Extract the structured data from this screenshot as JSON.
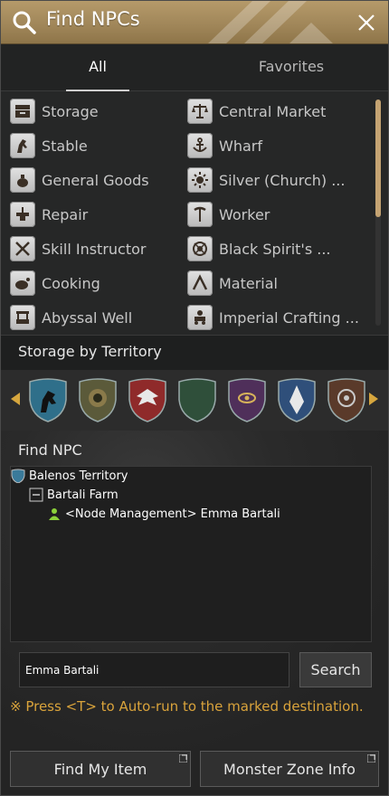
{
  "header": {
    "title": "Find NPCs"
  },
  "tabs": [
    {
      "label": "All",
      "active": true
    },
    {
      "label": "Favorites",
      "active": false
    }
  ],
  "categories": {
    "left": [
      {
        "label": "Storage",
        "icon": "storage-icon"
      },
      {
        "label": "Stable",
        "icon": "horse-icon"
      },
      {
        "label": "General Goods",
        "icon": "sack-icon"
      },
      {
        "label": "Repair",
        "icon": "anvil-icon"
      },
      {
        "label": "Skill Instructor",
        "icon": "crossed-weapons-icon"
      },
      {
        "label": "Cooking",
        "icon": "chicken-icon"
      },
      {
        "label": "Abyssal Well",
        "icon": "well-icon"
      }
    ],
    "right": [
      {
        "label": "Central Market",
        "icon": "scales-icon"
      },
      {
        "label": "Wharf",
        "icon": "anchor-icon"
      },
      {
        "label": "Silver (Church) ...",
        "icon": "sun-emblem-icon"
      },
      {
        "label": "Worker",
        "icon": "pickaxe-icon"
      },
      {
        "label": "Black Spirit's ...",
        "icon": "spirit-icon"
      },
      {
        "label": "Material",
        "icon": "wishbone-icon"
      },
      {
        "label": "Imperial Crafting ...",
        "icon": "cart-icon"
      }
    ]
  },
  "territory": {
    "title": "Storage by Territory",
    "shields": [
      {
        "name": "balenos",
        "color": "#2f6f8a",
        "icon": "horse-crest-icon"
      },
      {
        "name": "serendia",
        "color": "#5b5a3a",
        "icon": "lion-crest-icon"
      },
      {
        "name": "calpheon",
        "color": "#8f2a2a",
        "icon": "eagle-crest-icon"
      },
      {
        "name": "mediah",
        "color": "#2f4f3a",
        "icon": "crescent-crest-icon"
      },
      {
        "name": "valencia",
        "color": "#4f2f5a",
        "icon": "eye-crest-icon"
      },
      {
        "name": "kamasylvia",
        "color": "#2f4f7a",
        "icon": "leaf-crest-icon"
      },
      {
        "name": "drieghan",
        "color": "#5a3a2a",
        "icon": "ornament-crest-icon"
      }
    ]
  },
  "find_npc": {
    "title": "Find NPC",
    "tree": {
      "territory": "Balenos Territory",
      "node": "Bartali Farm",
      "npc": "<Node Management> Emma Bartali"
    },
    "search_value": "Emma Bartali",
    "search_button": "Search",
    "hint": "※ Press <T> to Auto-run to the marked destination."
  },
  "footer": {
    "find_item": "Find My Item",
    "monster_zone": "Monster Zone Info"
  },
  "colors": {
    "accent": "#c4a372",
    "hint": "#d9a33b",
    "header": "#a68b5e"
  }
}
